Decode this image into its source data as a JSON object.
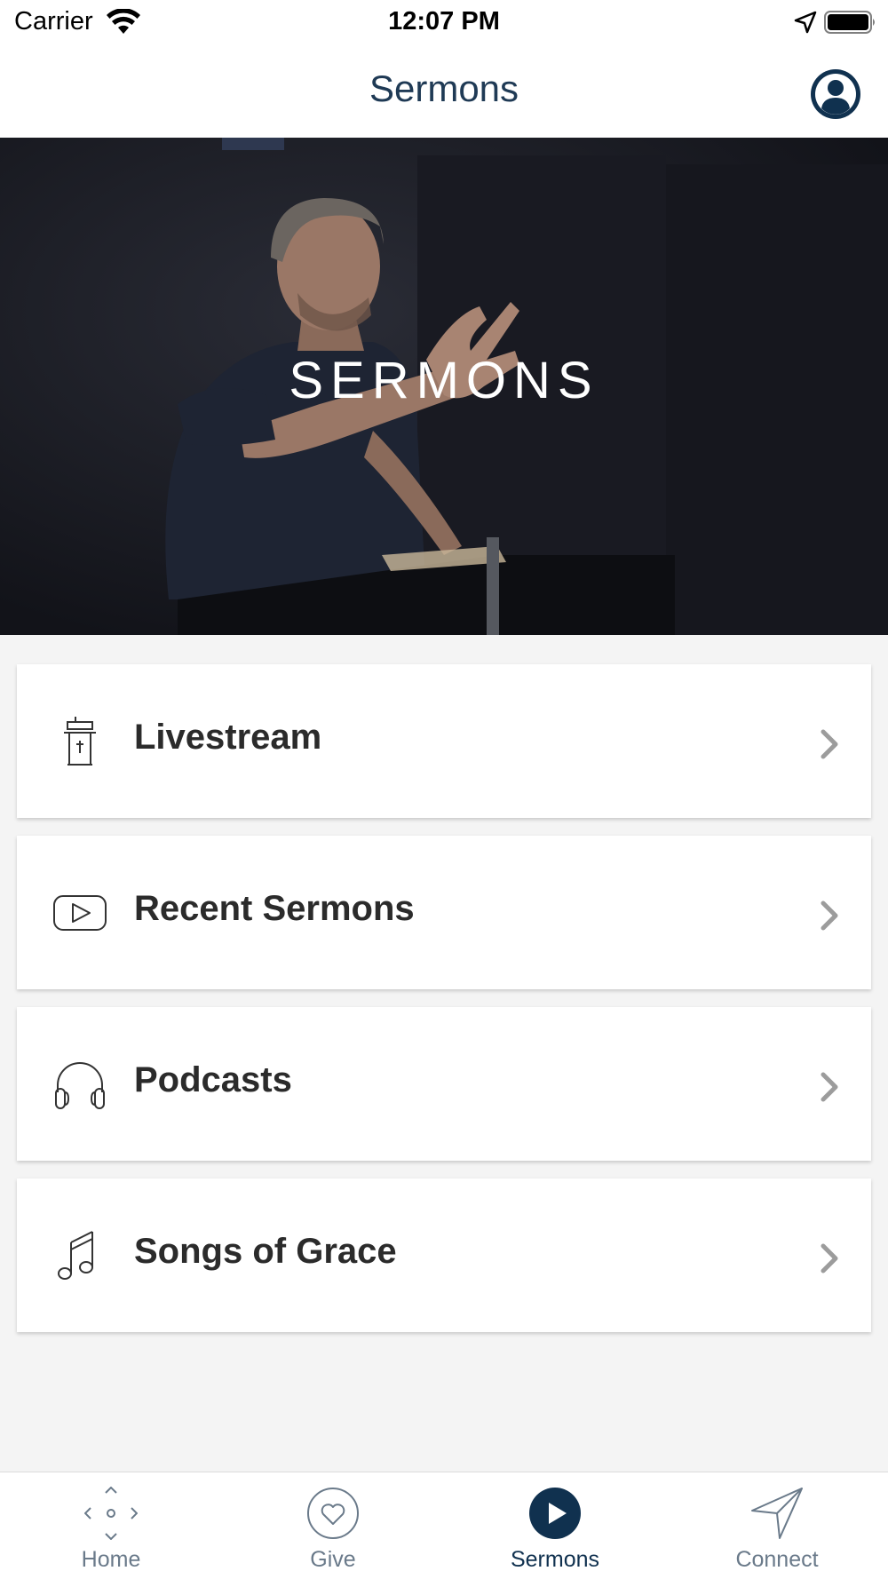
{
  "status_bar": {
    "carrier": "Carrier",
    "time": "12:07 PM"
  },
  "header": {
    "title": "Sermons"
  },
  "hero": {
    "text": "SERMONS"
  },
  "menu": {
    "items": [
      {
        "label": "Livestream",
        "icon": "pulpit-icon"
      },
      {
        "label": "Recent Sermons",
        "icon": "video-play-icon"
      },
      {
        "label": "Podcasts",
        "icon": "headphones-icon"
      },
      {
        "label": "Songs of Grace",
        "icon": "music-note-icon"
      }
    ]
  },
  "tab_bar": {
    "tabs": [
      {
        "label": "Home",
        "icon": "home-diamond-icon",
        "active": false
      },
      {
        "label": "Give",
        "icon": "heart-icon",
        "active": false
      },
      {
        "label": "Sermons",
        "icon": "play-icon",
        "active": true
      },
      {
        "label": "Connect",
        "icon": "send-arrow-icon",
        "active": false
      }
    ]
  },
  "colors": {
    "brand_navy": "#10314f",
    "header_title": "#1f3a55",
    "inactive_tab": "#6a7a8a",
    "background": "#f4f4f4"
  }
}
